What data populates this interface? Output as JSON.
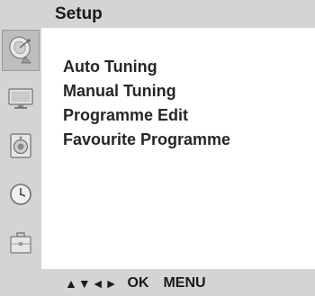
{
  "header": {
    "title": "Setup"
  },
  "sidebar": {
    "items": [
      {
        "icon": "satellite-dish-icon",
        "active": true
      },
      {
        "icon": "tv-screen-icon",
        "active": false
      },
      {
        "icon": "speaker-icon",
        "active": false
      },
      {
        "icon": "clock-icon",
        "active": false
      },
      {
        "icon": "briefcase-icon",
        "active": false
      }
    ]
  },
  "menu": {
    "items": [
      {
        "label": "Auto Tuning"
      },
      {
        "label": "Manual Tuning"
      },
      {
        "label": "Programme Edit"
      },
      {
        "label": "Favourite Programme"
      }
    ]
  },
  "footer": {
    "arrows": "▲▼◄►",
    "ok": "OK",
    "menu": "MENU"
  },
  "colors": {
    "bar_background": "#d4d4d4",
    "panel_background": "#ffffff",
    "text": "#262626"
  }
}
